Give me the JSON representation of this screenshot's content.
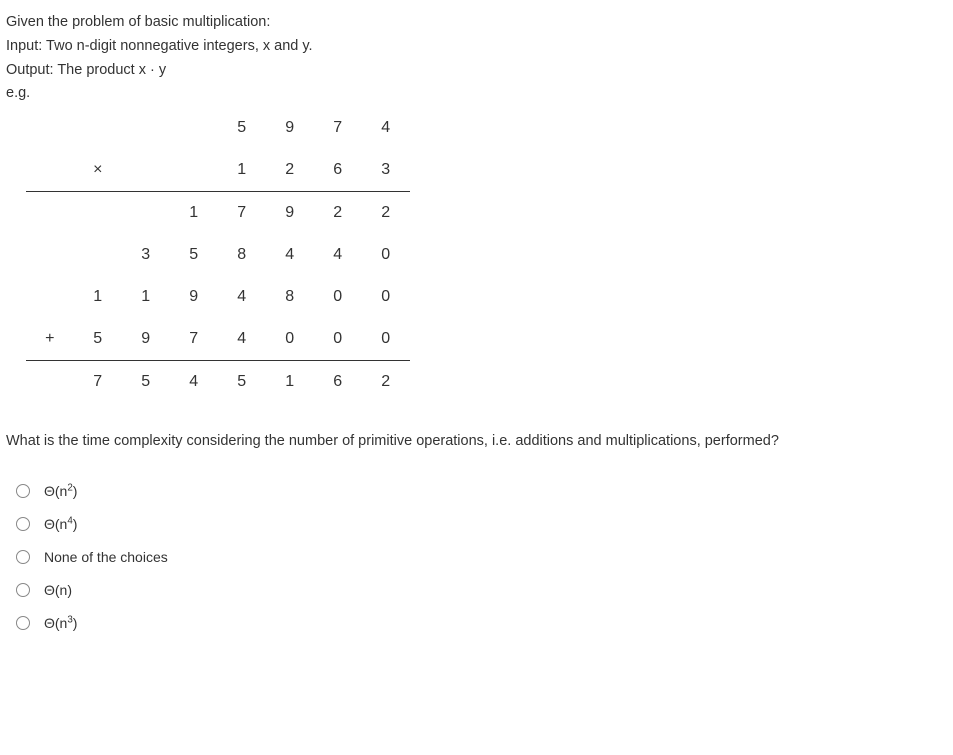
{
  "problem": {
    "line1": "Given the problem of basic multiplication:",
    "line2": "Input: Two n-digit nonnegative integers, x and y.",
    "line3": "Output: The product x · y",
    "eg": "e.g."
  },
  "mult": {
    "r1": [
      "",
      "",
      "",
      "",
      "5",
      "9",
      "7",
      "4"
    ],
    "r2": [
      "",
      "×",
      "",
      "",
      "1",
      "2",
      "6",
      "3"
    ],
    "r3": [
      "",
      "",
      "",
      "1",
      "7",
      "9",
      "2",
      "2"
    ],
    "r4": [
      "",
      "",
      "3",
      "5",
      "8",
      "4",
      "4",
      "0"
    ],
    "r5": [
      "",
      "1",
      "1",
      "9",
      "4",
      "8",
      "0",
      "0"
    ],
    "r6": [
      "+",
      "5",
      "9",
      "7",
      "4",
      "0",
      "0",
      "0"
    ],
    "r7": [
      "",
      "7",
      "5",
      "4",
      "5",
      "1",
      "6",
      "2"
    ]
  },
  "question": "What is the time complexity considering the number of primitive operations, i.e. additions and multiplications, performed?",
  "options": {
    "o1": {
      "theta": "Θ(n",
      "exp": "2",
      "close": ")"
    },
    "o2": {
      "theta": "Θ(n",
      "exp": "4",
      "close": ")"
    },
    "o3": {
      "text": "None of the choices"
    },
    "o4": {
      "theta": "Θ(n)",
      "exp": "",
      "close": ""
    },
    "o5": {
      "theta": "Θ(n",
      "exp": "3",
      "close": ")"
    }
  }
}
